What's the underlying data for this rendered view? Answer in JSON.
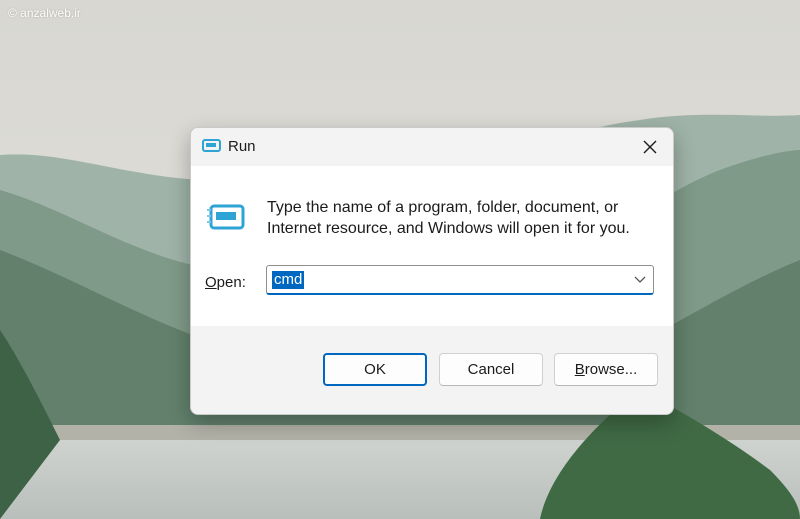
{
  "watermark": "© anzalweb.ir",
  "dialog": {
    "title": "Run",
    "description": "Type the name of a program, folder, document, or Internet resource, and Windows will open it for you.",
    "open_label_accel": "O",
    "open_label_rest": "pen:",
    "open_value": "cmd",
    "buttons": {
      "ok": "OK",
      "cancel": "Cancel",
      "browse_accel": "B",
      "browse_rest": "rowse..."
    },
    "icons": {
      "title": "run-icon",
      "close": "close-icon",
      "main": "run-icon",
      "dropdown": "chevron-down-icon"
    }
  },
  "colors": {
    "accent": "#0067c0",
    "run_icon": "#2ea3d6",
    "titlebar": "#f3f3f3"
  }
}
